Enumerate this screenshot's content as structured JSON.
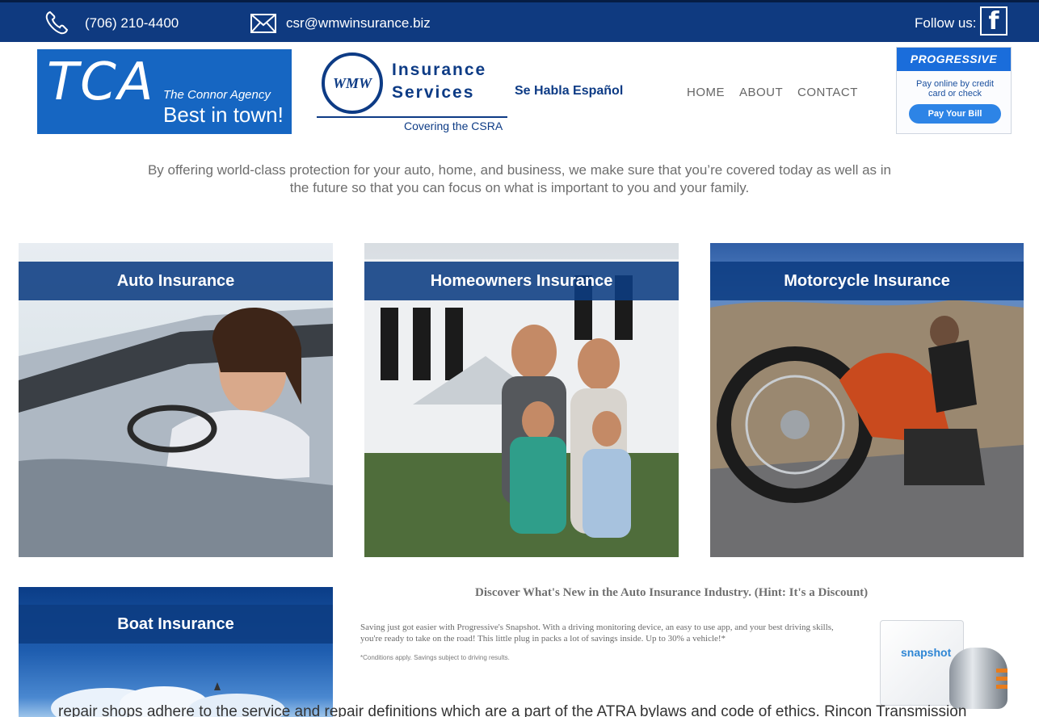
{
  "topbar": {
    "phone": "(706) 210-4400",
    "email": "csr@wmwinsurance.biz",
    "follow_label": "Follow us:",
    "facebook_glyph": "f",
    "phone_icon": "phone-icon",
    "email_icon": "envelope-icon",
    "facebook_icon": "facebook-icon"
  },
  "header": {
    "tca_logo": {
      "big": "TCA",
      "agency": "The Connor Agency",
      "slogan": "Best in town!"
    },
    "wmw_logo": {
      "monogram": "WMW",
      "line1": "Insurance",
      "line2": "Services",
      "tagline": "Covering the CSRA"
    },
    "habla": "Se Habla Español",
    "nav": {
      "home": "HOME",
      "about": "ABOUT",
      "contact": "CONTACT"
    },
    "progressive": {
      "brand": "PROGRESSIVE",
      "text": "Pay online by credit card or check",
      "button": "Pay Your Bill"
    }
  },
  "tagline": "By offering world-class protection for your auto, home, and business, we make sure that you’re covered today as well as in the future so that you can focus on what is important to you and your family.",
  "cards": {
    "auto": "Auto Insurance",
    "home": "Homeowners Insurance",
    "moto": "Motorcycle Insurance",
    "boat": "Boat Insurance"
  },
  "promo": {
    "title": "Discover What's New in the Auto Insurance Industry. (Hint: It's a Discount)",
    "body": "Saving just got easier with Progressive's Snapshot. With a driving monitoring device, an easy to use app, and your best driving skills, you're ready to take on the road! This little plug in packs a lot of savings inside. Up to 30% a vehicle!*",
    "note": "*Conditions apply. Savings subject to driving results.",
    "snapshot_label": "snapshot"
  },
  "bottom_text": "repair shops adhere to the service and repair definitions which are a part of the ATRA bylaws and code of ethics. Rincon Transmission",
  "colors": {
    "brand_blue": "#0f3a80",
    "tca_blue": "#1666c2",
    "progressive_blue": "#1a6ddb"
  }
}
